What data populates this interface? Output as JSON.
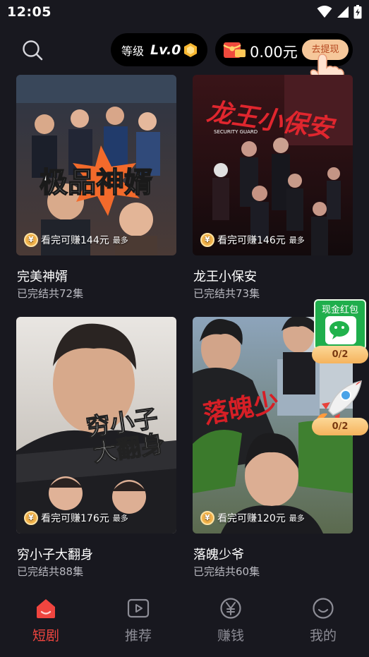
{
  "status_bar": {
    "time": "12:05"
  },
  "header": {
    "level_label": "等级",
    "level_value": "Lv.0",
    "wallet_amount": "0.00元",
    "withdraw_label": "去提现"
  },
  "dramas": [
    {
      "title": "完美神婿",
      "status": "已完结共72集",
      "earn": "看完可赚144元",
      "earn_tag": "最多",
      "poster_text": "极品神婿"
    },
    {
      "title": "龙王小保安",
      "status": "已完结共73集",
      "earn": "看完可赚146元",
      "earn_tag": "最多",
      "poster_text": "龙王小保安",
      "poster_small": "SECURITY GUARD"
    },
    {
      "title": "穷小子大翻身",
      "status": "已完结共88集",
      "earn": "看完可赚176元",
      "earn_tag": "最多",
      "poster_text_1": "穷小子",
      "poster_text_2": "大翻身"
    },
    {
      "title": "落魄少爷",
      "status": "已完结共60集",
      "earn": "看完可赚120元",
      "earn_tag": "最多",
      "poster_text": "落魄少"
    }
  ],
  "widgets": {
    "cash_title": "现金红包",
    "cash_progress": "0/2",
    "rocket_progress": "0/2"
  },
  "nav": [
    {
      "label": "短剧",
      "icon": "home-icon",
      "active": true
    },
    {
      "label": "推荐",
      "icon": "play-icon",
      "active": false
    },
    {
      "label": "赚钱",
      "icon": "yuan-icon",
      "active": false
    },
    {
      "label": "我的",
      "icon": "smile-icon",
      "active": false
    }
  ],
  "colors": {
    "background": "#18181f",
    "accent_active": "#f0453f",
    "nav_inactive": "#8d8d96",
    "coin": "#f2b24a",
    "withdraw_bg": "#f6c79a"
  }
}
